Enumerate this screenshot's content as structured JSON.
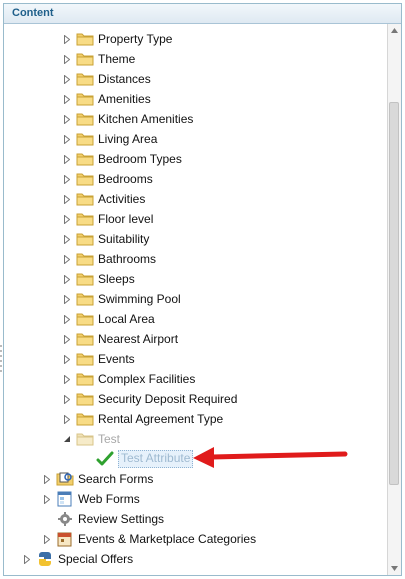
{
  "header": {
    "title": "Content"
  },
  "tree": {
    "attribute_items": [
      "Property Type",
      "Theme",
      "Distances",
      "Amenities",
      "Kitchen Amenities",
      "Living Area",
      "Bedroom Types",
      "Bedrooms",
      "Activities",
      "Floor level",
      "Suitability",
      "Bathrooms",
      "Sleeps",
      "Swimming Pool",
      "Local Area",
      "Nearest Airport",
      "Events",
      "Complex Facilities",
      "Security Deposit Required",
      "Rental Agreement Type"
    ],
    "expanded_item": "Test",
    "child_item": "Test Attribute",
    "sections": [
      {
        "label": "Search Forms",
        "icon": "search-forms-icon"
      },
      {
        "label": "Web Forms",
        "icon": "web-forms-icon"
      },
      {
        "label": "Review Settings",
        "icon": "gear-icon"
      },
      {
        "label": "Events & Marketplace Categories",
        "icon": "calendar-icon"
      }
    ],
    "bottom_item": {
      "label": "Special Offers",
      "icon": "python-icon"
    }
  },
  "colors": {
    "arrow": "#e01b1b",
    "folder": "#f2cf6c",
    "check": "#2fa12f"
  }
}
